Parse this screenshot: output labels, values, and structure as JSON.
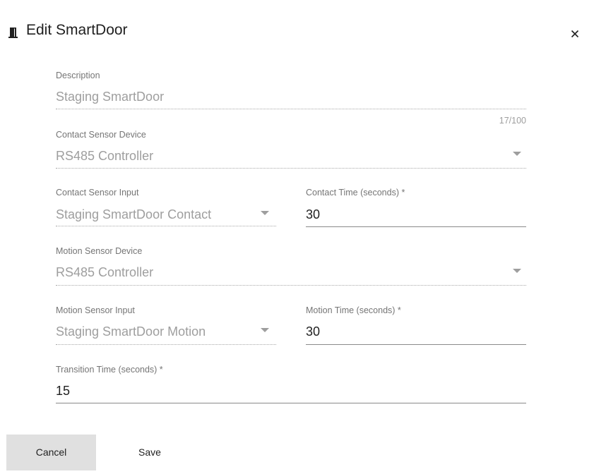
{
  "dialog": {
    "title": "Edit SmartDoor",
    "icon": "door-icon",
    "close_icon": "close-icon"
  },
  "fields": {
    "description": {
      "label": "Description",
      "value": "Staging SmartDoor",
      "counter": "17/100"
    },
    "contact_sensor_device": {
      "label": "Contact Sensor Device",
      "value": "RS485 Controller"
    },
    "contact_sensor_input": {
      "label": "Contact Sensor Input",
      "value": "Staging SmartDoor Contact"
    },
    "contact_time": {
      "label": "Contact Time (seconds) *",
      "value": "30"
    },
    "motion_sensor_device": {
      "label": "Motion Sensor Device",
      "value": "RS485 Controller"
    },
    "motion_sensor_input": {
      "label": "Motion Sensor Input",
      "value": "Staging SmartDoor Motion"
    },
    "motion_time": {
      "label": "Motion Time (seconds) *",
      "value": "30"
    },
    "transition_time": {
      "label": "Transition Time (seconds) *",
      "value": "15"
    }
  },
  "actions": {
    "cancel_label": "Cancel",
    "save_label": "Save"
  }
}
